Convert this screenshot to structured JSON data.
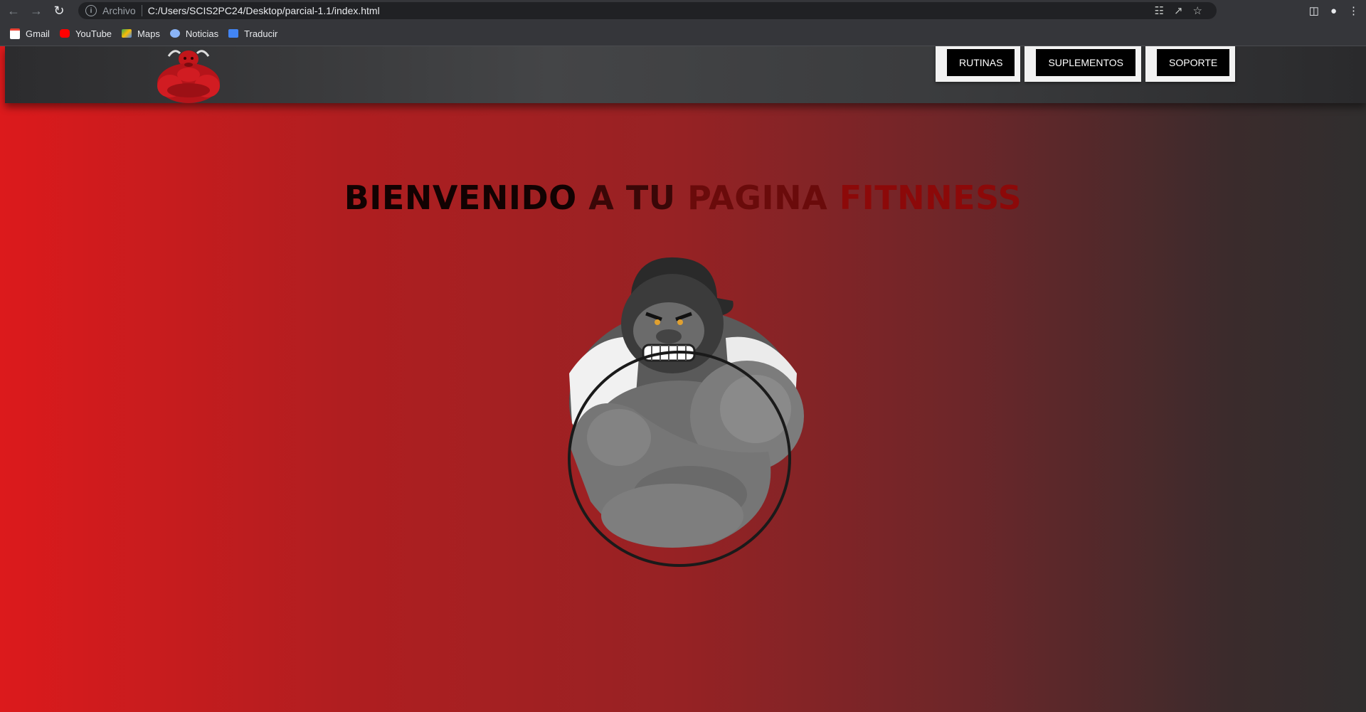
{
  "browser": {
    "scheme_label": "Archivo",
    "url": "C:/Users/SCIS2PC24/Desktop/parcial-1.1/index.html",
    "bookmarks": [
      {
        "label": "Gmail",
        "icon": "gmail-icon"
      },
      {
        "label": "YouTube",
        "icon": "youtube-icon"
      },
      {
        "label": "Maps",
        "icon": "maps-icon"
      },
      {
        "label": "Noticias",
        "icon": "news-icon"
      },
      {
        "label": "Traducir",
        "icon": "translate-icon"
      }
    ]
  },
  "site": {
    "nav": [
      {
        "label": "RUTINAS"
      },
      {
        "label": "SUPLEMENTOS"
      },
      {
        "label": "SOPORTE"
      }
    ],
    "title_parts": [
      "BIENVENIDO",
      "A TU",
      "PAGINA",
      "FITNNESS"
    ]
  },
  "colors": {
    "page_left": "#dc1a1c",
    "page_right": "#302e2e",
    "header": "#3a3b3d",
    "nav_button": "#000000"
  }
}
